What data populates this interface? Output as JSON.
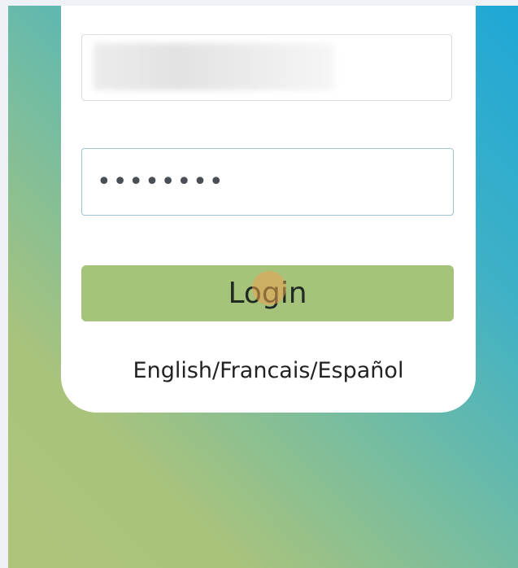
{
  "login_form": {
    "username_value": "",
    "password_value": "••••••••",
    "login_label": "Login",
    "language_links": "English/Francais/Español"
  },
  "colors": {
    "button": "#a6c37b",
    "gradient_start": "#1fa7d6",
    "gradient_end": "#aec47a",
    "card": "#ffffff"
  }
}
